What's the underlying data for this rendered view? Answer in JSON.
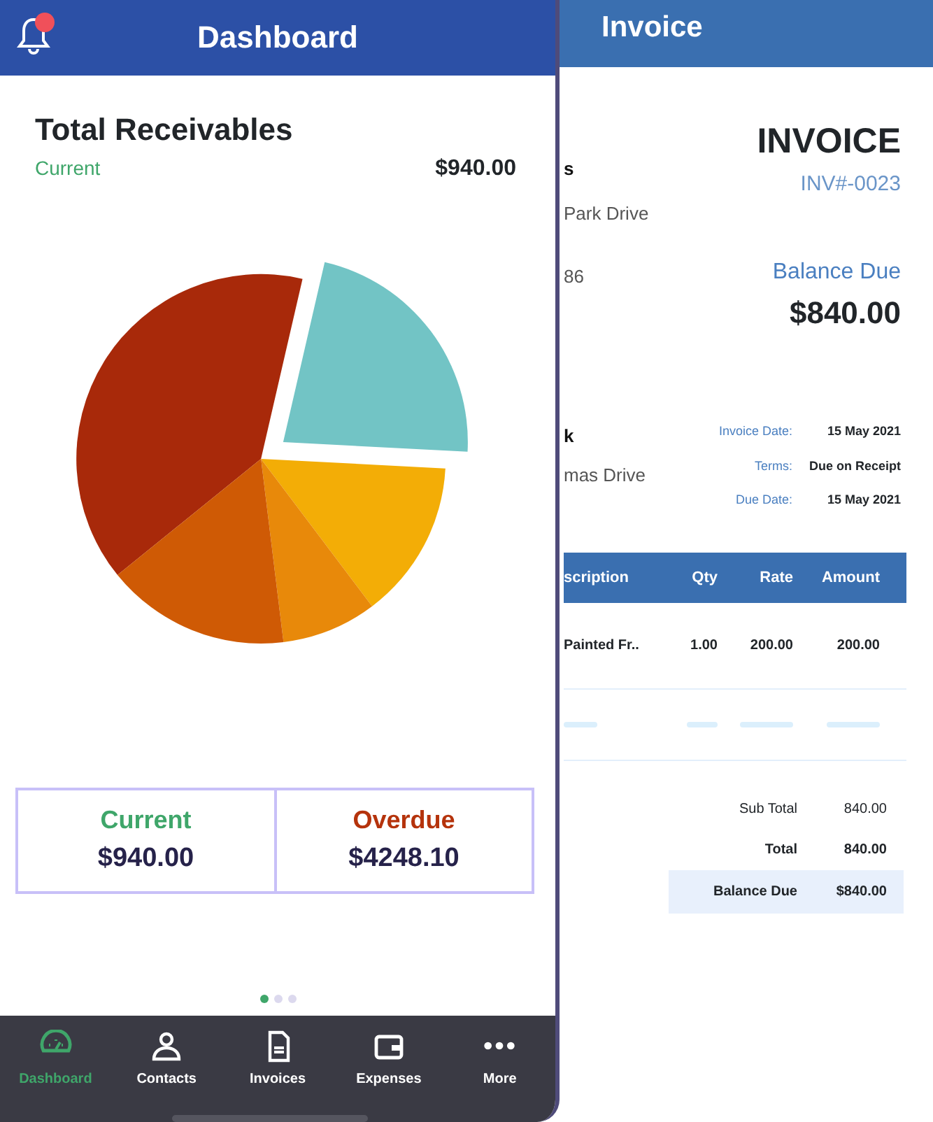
{
  "phone": {
    "title": "Dashboard",
    "notification": true,
    "receivables": {
      "title": "Total Receivables",
      "label": "Current",
      "amount": "$940.00"
    },
    "summary": [
      {
        "label": "Current",
        "amount": "$940.00",
        "color": "#3fa66a"
      },
      {
        "label": "Overdue",
        "amount": "$4248.10",
        "color": "#b5330c"
      }
    ],
    "pager": [
      {
        "selected": true
      },
      {
        "selected": false
      },
      {
        "selected": false
      }
    ],
    "nav": [
      {
        "label": "Dashboard",
        "selected": true
      },
      {
        "label": "Contacts",
        "selected": false
      },
      {
        "label": "Invoices",
        "selected": false
      },
      {
        "label": "Expenses",
        "selected": false
      },
      {
        "label": "More",
        "selected": false
      }
    ]
  },
  "invoice": {
    "title": "Invoice",
    "heading": "INVOICE",
    "number": "INV#-0023",
    "from_lines": [
      "s",
      "Park Drive",
      "86"
    ],
    "balance_label": "Balance Due",
    "balance": "$840.00",
    "to_lines": [
      "k",
      "mas Drive"
    ],
    "meta": [
      {
        "label": "Invoice Date:",
        "value": "15 May 2021"
      },
      {
        "label": "Terms:",
        "value": "Due on Receipt"
      },
      {
        "label": "Due Date:",
        "value": "15 May 2021"
      }
    ],
    "columns": [
      "scription",
      "Qty",
      "Rate",
      "Amount"
    ],
    "rows": [
      [
        "Painted Fr..",
        "1.00",
        "200.00",
        "200.00"
      ]
    ],
    "totals": [
      {
        "label": "Sub Total",
        "value": "840.00",
        "kind": "plain"
      },
      {
        "label": "Total",
        "value": "840.00",
        "kind": "bold"
      },
      {
        "label": "Balance Due",
        "value": "$840.00",
        "kind": "highlight"
      }
    ]
  }
}
